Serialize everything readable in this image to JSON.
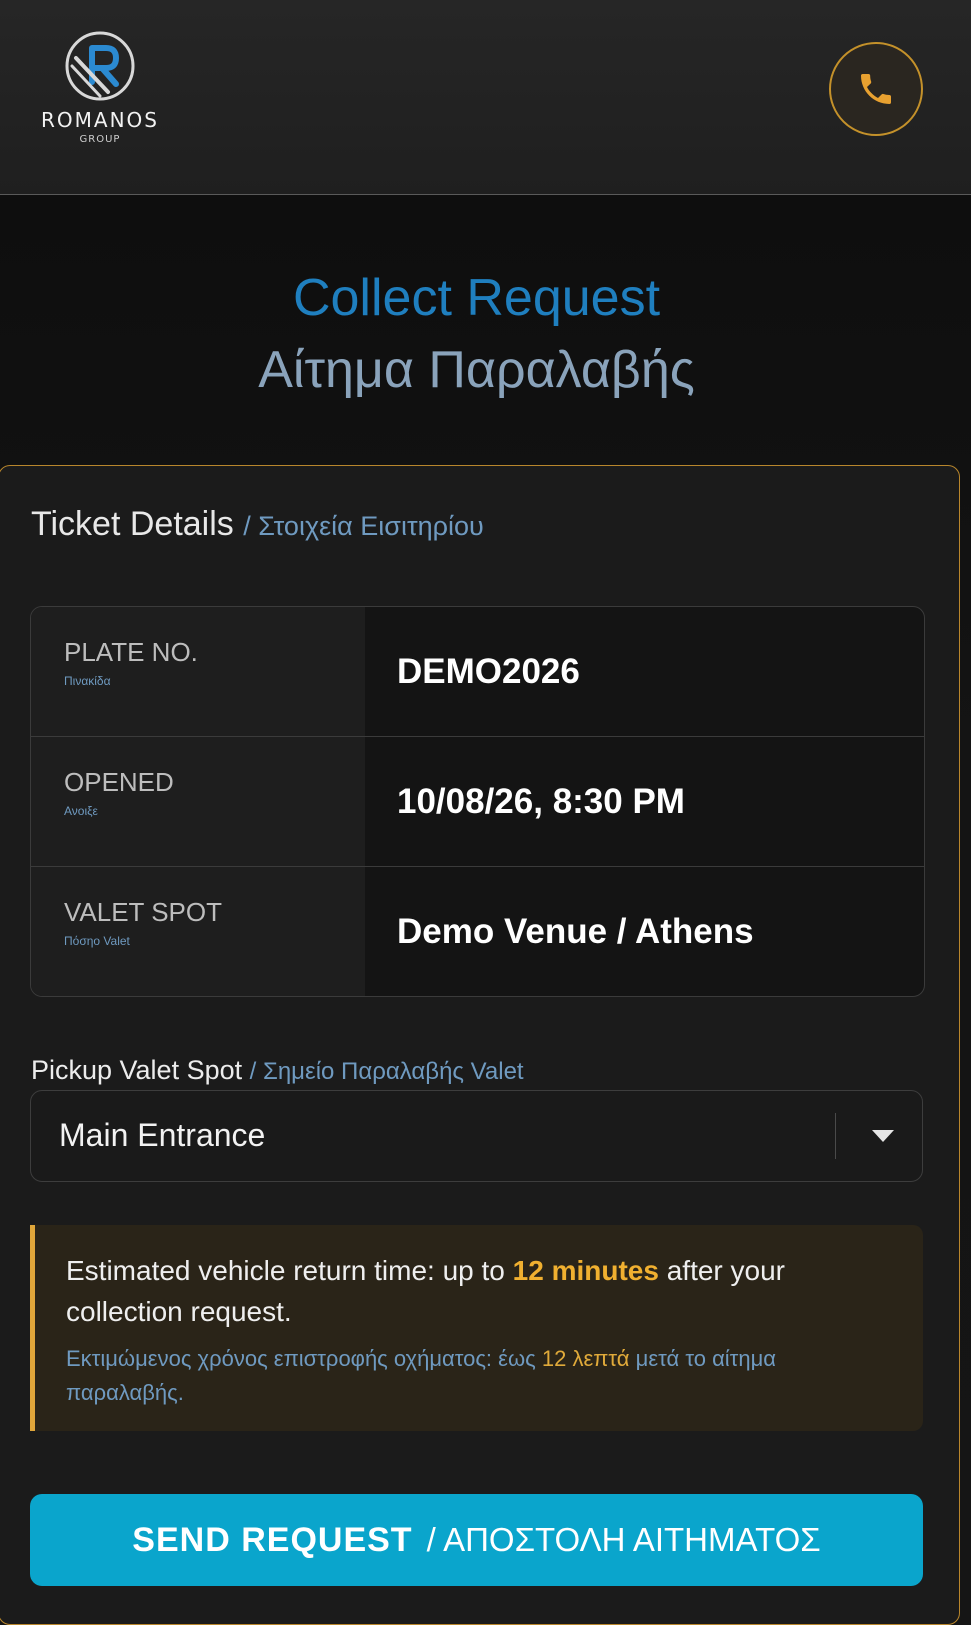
{
  "header": {
    "logo_name": "ROMANOS",
    "logo_sub": "GROUP",
    "call_icon": "phone-icon"
  },
  "page": {
    "title_en": "Collect Request",
    "title_gr": "Αίτημα Παραλαβής"
  },
  "ticket": {
    "section_title": "Ticket Details",
    "section_title_gr": "/ Στοιχεία Εισιτηρίου",
    "rows": [
      {
        "label_en": "PLATE NO.",
        "label_gr": "Πινακίδα",
        "value": "DEMO2026"
      },
      {
        "label_en": "OPENED",
        "label_gr": "Ανοιξε",
        "value": "10/08/26, 8:30 PM"
      },
      {
        "label_en": "VALET SPOT",
        "label_gr": "Πόσηο Valet",
        "value": "Demo Venue / Athens"
      }
    ]
  },
  "pickup": {
    "label": "Pickup Valet Spot",
    "label_gr": "/ Σημείο Παραλαβής Valet",
    "selected": "Main Entrance",
    "caret_icon": "chevron-down-icon"
  },
  "notice": {
    "en_before": "Estimated vehicle return time: up to ",
    "en_highlight": "12 minutes",
    "en_after": " after your collection request.",
    "gr_before": "Εκτιμώμενος χρόνος επιστροφής οχήματος: έως ",
    "gr_highlight": "12 λεπτά",
    "gr_after": " μετά το αίτημα παραλαβής."
  },
  "send": {
    "label_en": "SEND REQUEST",
    "label_gr": "/ ΑΠΟΣΤΟΛΗ ΑΙΤΗΜΑΤΟΣ"
  },
  "colors": {
    "accent_gold": "#c4912a",
    "title_blue": "#1f7fbf",
    "button_cyan": "#0aa5cc"
  }
}
